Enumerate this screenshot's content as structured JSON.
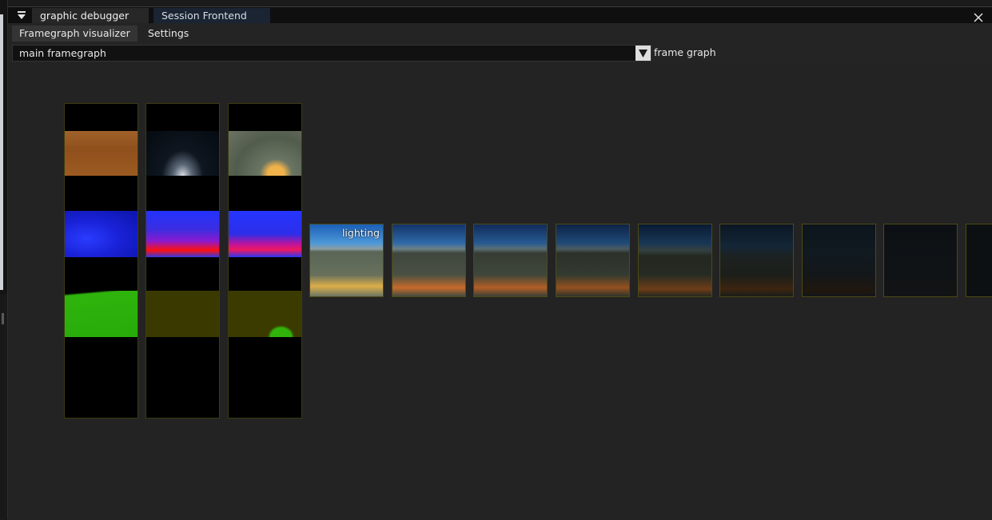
{
  "window": {
    "tabs": [
      {
        "label": "graphic debugger",
        "active": true
      },
      {
        "label": "Session Frontend",
        "active": false
      }
    ]
  },
  "menu": {
    "items": [
      {
        "label": "Framegraph visualizer",
        "active": true
      },
      {
        "label": "Settings",
        "active": false
      }
    ]
  },
  "framegraph_select": {
    "value": "main framegraph",
    "label": "frame graph"
  },
  "gbuffer_columns": 3,
  "lighting_chain": {
    "first_label": "lighting",
    "count": 9
  },
  "colors": {
    "node_border": "#4d4a14",
    "albedo": "#9a5a26",
    "normal": "#1f34e6",
    "mask_green": "#27b20a",
    "mask_olive": "#3a3a00"
  }
}
